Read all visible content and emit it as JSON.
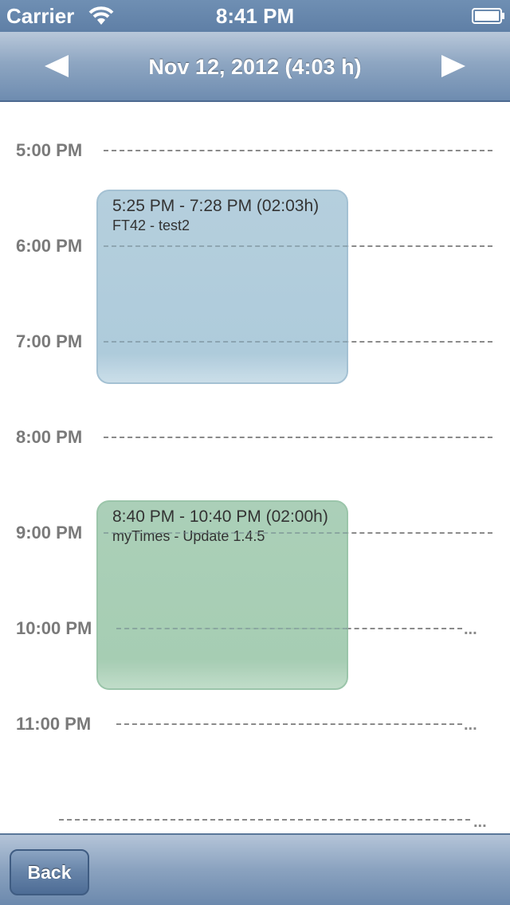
{
  "status_bar": {
    "carrier": "Carrier",
    "time": "8:41 PM",
    "wifi_icon": "wifi-icon",
    "battery_icon": "battery-icon"
  },
  "nav_bar": {
    "title": "Nov 12, 2012 (4:03 h)",
    "prev_icon": "left-triangle-arrow",
    "next_icon": "right-triangle-arrow"
  },
  "calendar": {
    "hours": [
      "5:00 PM",
      "6:00 PM",
      "7:00 PM",
      "8:00 PM",
      "9:00 PM",
      "10:00 PM",
      "11:00 PM"
    ],
    "ellipsis": "...",
    "events": [
      {
        "time": "5:25 PM - 7:28 PM (02:03h)",
        "title": "FT42 - test2",
        "color": "#a8c7d9"
      },
      {
        "time": "8:40 PM - 10:40 PM (02:00h)",
        "title": "myTimes - Update 1.4.5",
        "color": "#9fc9ad"
      }
    ]
  },
  "toolbar": {
    "back_label": "Back"
  },
  "colors": {
    "nav_bar": "#6e8cb0",
    "status_bar": "#5f7fa6",
    "hour_label": "#7a7a7a"
  }
}
